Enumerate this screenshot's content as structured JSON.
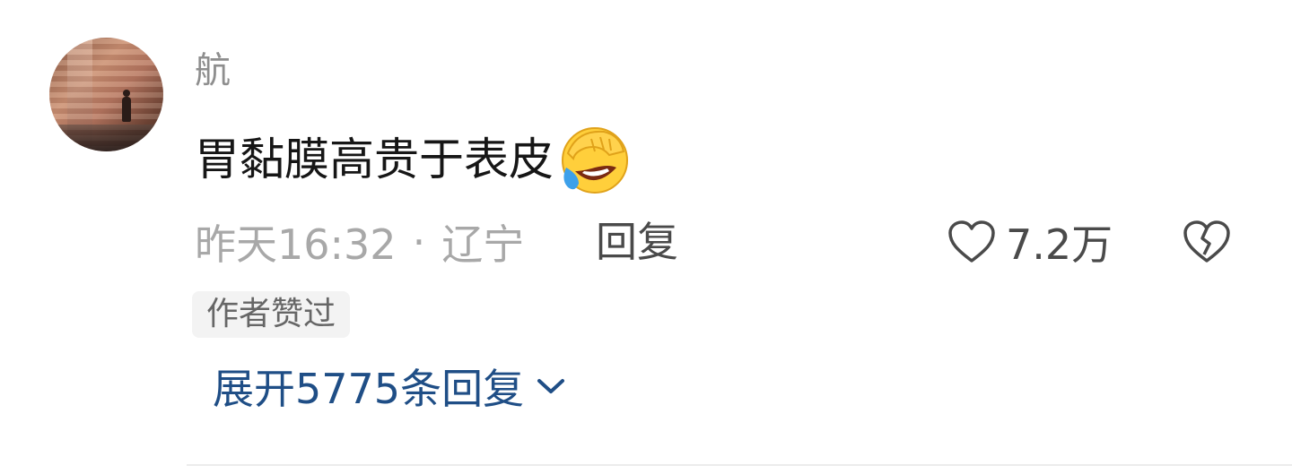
{
  "comment": {
    "username": "航",
    "text": "胃黏膜高贵于表皮",
    "emoji_icon": "facepalm-laughing-crying-emoji",
    "time": "昨天16:32",
    "separator": "·",
    "location": "辽宁",
    "reply_label": "回复",
    "like_count": "7.2万",
    "badge": "作者赞过",
    "expand_replies_label": "展开5775条回复"
  },
  "icons": {
    "like": "heart-outline-icon",
    "dislike": "broken-heart-icon",
    "expand": "chevron-down-icon"
  },
  "colors": {
    "link_blue": "#1f4e86",
    "meta_gray": "#a8a8a8",
    "username_gray": "#8e8e8e"
  }
}
